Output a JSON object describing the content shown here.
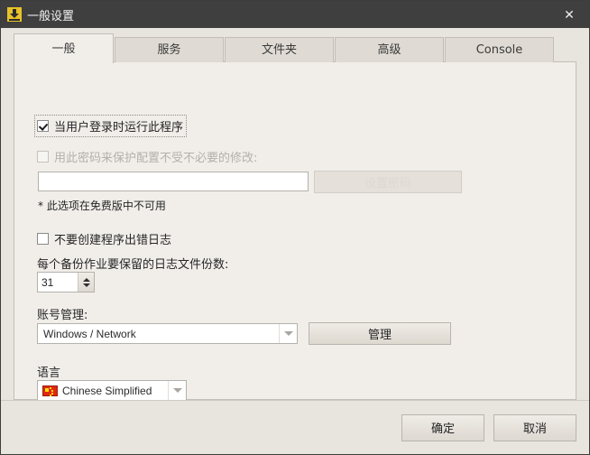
{
  "window": {
    "title": "一般设置",
    "icon": "app-download-icon",
    "close_label": "✕",
    "titlebar_color": "#3f3f3f",
    "surface_color": "#e8e4de",
    "panel_color": "#f1eeea",
    "accent_color": "#e8c22a"
  },
  "tabs": [
    {
      "label": "一般",
      "active": true
    },
    {
      "label": "服务",
      "active": false
    },
    {
      "label": "文件夹",
      "active": false
    },
    {
      "label": "高级",
      "active": false
    },
    {
      "label": "Console",
      "active": false
    }
  ],
  "general": {
    "run_at_logon": {
      "label": "当用户登录时运行此程序",
      "checked": true,
      "enabled": true
    },
    "protect_with_password": {
      "label": "用此密码来保护配置不受不必要的修改:",
      "checked": false,
      "enabled": false
    },
    "password_field": {
      "value": "",
      "placeholder": "",
      "enabled": false
    },
    "set_password_button": {
      "label": "设置密码",
      "enabled": false
    },
    "free_version_note": "* 此选项在免费版中不可用",
    "no_error_log": {
      "label": "不要创建程序出错日志",
      "checked": false,
      "enabled": true
    },
    "log_files_kept": {
      "label": "每个备份作业要保留的日志文件份数:",
      "value": "31"
    },
    "account_management": {
      "label": "账号管理:",
      "selected": "Windows / Network",
      "options": [
        "Windows / Network"
      ],
      "manage_button": "管理"
    },
    "language": {
      "label": "语言",
      "selected": "Chinese Simplified",
      "flag": "china-flag-icon",
      "options": [
        "Chinese Simplified"
      ]
    }
  },
  "footer": {
    "ok_label": "确定",
    "cancel_label": "取消"
  }
}
